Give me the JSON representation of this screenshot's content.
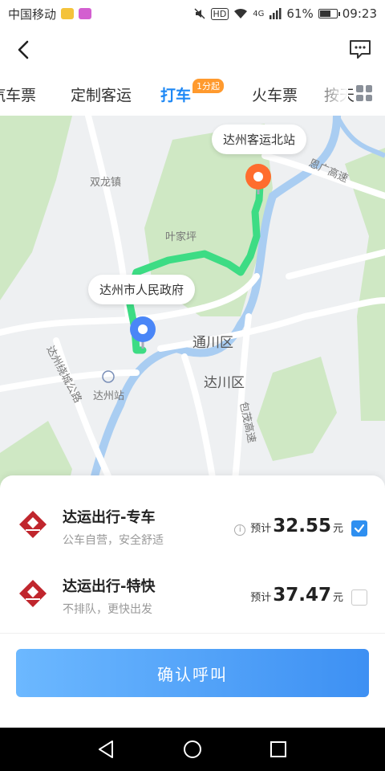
{
  "status_bar": {
    "carrier": "中国移动",
    "network": "4G",
    "battery": "61%",
    "battery_level": 0.61,
    "time": "09:23"
  },
  "header": {
    "back_icon": "chevron-left-icon",
    "message_icon": "message-icon"
  },
  "tabs": {
    "items": [
      "汽车票",
      "定制客运",
      "打车",
      "火车票",
      "按天"
    ],
    "active": "打车",
    "active_badge": "1分起"
  },
  "map": {
    "places": {
      "shuanglong": "双龙镇",
      "yejiaping": "叶家坪",
      "tongchuan": "通川区",
      "dachuan": "达川区",
      "dazhou_station": "达州站",
      "enguang_highway": "恩广高速",
      "baomao_highway": "包茂高速",
      "dazhou_ring": "达州绕城公路"
    },
    "origin_label": "达州市人民政府",
    "destination_label": "达州客运北站",
    "route_color": "#3ddc84",
    "origin_color": "#4a86f7",
    "destination_color": "#ff6d2e"
  },
  "options": [
    {
      "title": "达运出行-专车",
      "subtitle": "公车自营，安全舒适",
      "price_prefix": "预计",
      "price": "32.55",
      "unit": "元",
      "selected": true
    },
    {
      "title": "达运出行-特快",
      "subtitle": "不排队，更快出发",
      "price_prefix": "预计",
      "price": "37.47",
      "unit": "元",
      "selected": false
    }
  ],
  "confirm_button": "确认呼叫",
  "colors": {
    "accent": "#1e88f5",
    "badge": "#ff9a2e",
    "checkbox": "#2e8ff0"
  }
}
